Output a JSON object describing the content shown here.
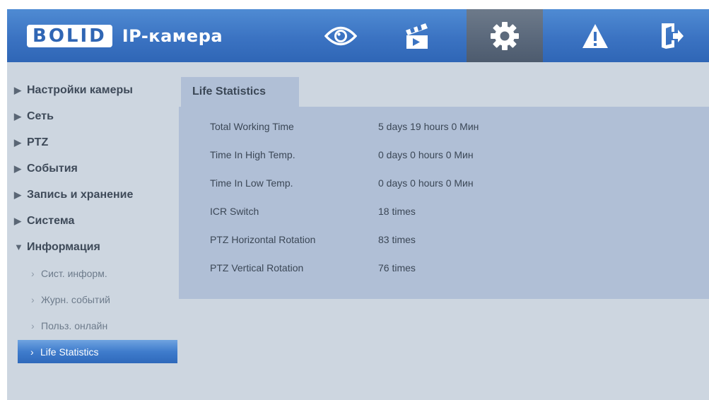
{
  "header": {
    "logo_text": "BOLID",
    "title": "IP-камера",
    "nav": [
      {
        "icon": "eye-icon"
      },
      {
        "icon": "clapperboard-icon"
      },
      {
        "icon": "gear-icon",
        "active": true
      },
      {
        "icon": "warning-icon"
      },
      {
        "icon": "logout-icon"
      }
    ]
  },
  "sidebar": {
    "items": [
      {
        "label": "Настройки камеры"
      },
      {
        "label": "Сеть"
      },
      {
        "label": "PTZ"
      },
      {
        "label": "События"
      },
      {
        "label": "Запись и хранение"
      },
      {
        "label": "Система"
      },
      {
        "label": "Информация"
      }
    ],
    "subitems": [
      {
        "label": "Сист. информ."
      },
      {
        "label": "Журн. событий"
      },
      {
        "label": "Польз. онлайн"
      },
      {
        "label": "Life Statistics"
      }
    ]
  },
  "main": {
    "tab_label": "Life Statistics",
    "stats": [
      {
        "label": "Total Working Time",
        "value": "5 days 19 hours 0 Мин"
      },
      {
        "label": "Time In High Temp.",
        "value": "0 days 0 hours 0 Мин"
      },
      {
        "label": "Time In Low Temp.",
        "value": "0 days 0 hours 0 Мин"
      },
      {
        "label": "ICR Switch",
        "value": "18 times"
      },
      {
        "label": "PTZ Horizontal Rotation",
        "value": "83 times"
      },
      {
        "label": "PTZ Vertical Rotation",
        "value": "76 times"
      }
    ]
  },
  "colors": {
    "header": "#3b73c2",
    "background": "#cdd6e0",
    "panel": "#b0bfd6",
    "selected": "#3f7ccc"
  }
}
